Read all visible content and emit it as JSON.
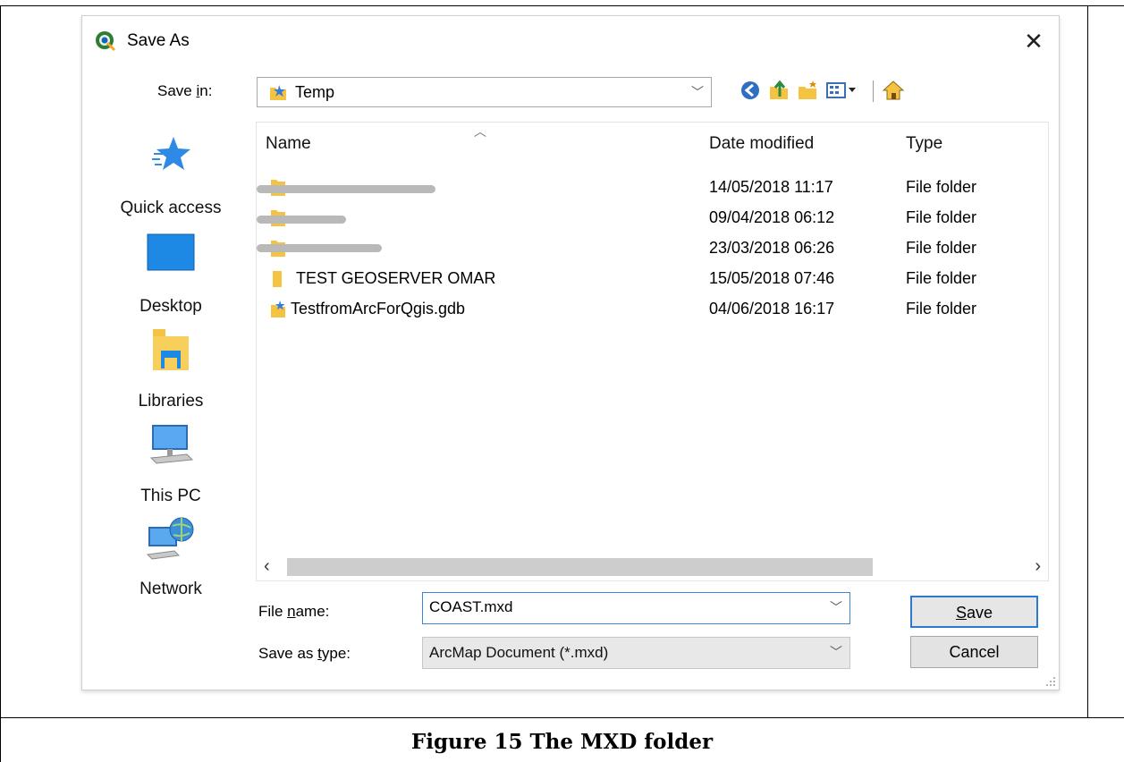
{
  "dialog": {
    "title": "Save As",
    "close_glyph": "✕"
  },
  "save_in": {
    "label_prefix": "Save ",
    "label_accel": "i",
    "label_suffix": "n:",
    "value": "Temp"
  },
  "toolbar": {
    "buttons": [
      "back-icon",
      "up-folder-icon",
      "new-folder-icon",
      "view-menu-icon",
      "home-icon"
    ]
  },
  "places": [
    {
      "label": "Quick access",
      "icon": "star-icon"
    },
    {
      "label": "Desktop",
      "icon": "desktop-icon"
    },
    {
      "label": "Libraries",
      "icon": "libraries-icon"
    },
    {
      "label": "This PC",
      "icon": "computer-icon"
    },
    {
      "label": "Network",
      "icon": "network-icon"
    }
  ],
  "file_list": {
    "columns": {
      "name": "Name",
      "date": "Date modified",
      "type": "Type"
    },
    "rows": [
      {
        "name": "",
        "date": "14/05/2018 11:17",
        "type": "File folder",
        "redacted": true
      },
      {
        "name": "",
        "date": "09/04/2018 06:12",
        "type": "File folder",
        "redacted": true
      },
      {
        "name": "",
        "date": "23/03/2018 06:26",
        "type": "File folder",
        "redacted": true
      },
      {
        "name": "TEST GEOSERVER OMAR",
        "date": "15/05/2018 07:46",
        "type": "File folder",
        "redacted": false
      },
      {
        "name": "TestfromArcForQgis.gdb",
        "date": "04/06/2018 16:17",
        "type": "File folder",
        "redacted": false
      }
    ]
  },
  "file_name": {
    "label_prefix": "File ",
    "label_accel": "n",
    "label_suffix": "ame:",
    "value": "COAST.mxd"
  },
  "save_as_type": {
    "label_prefix": "Save as ",
    "label_accel": "t",
    "label_suffix": "ype:",
    "value": "ArcMap Document (*.mxd)"
  },
  "buttons": {
    "save_accel": "S",
    "save_rest": "ave",
    "cancel": "Cancel"
  },
  "caption": "Figure 15 The MXD folder",
  "colors": {
    "accent": "#2b79d1",
    "folder": "#f5c342"
  }
}
